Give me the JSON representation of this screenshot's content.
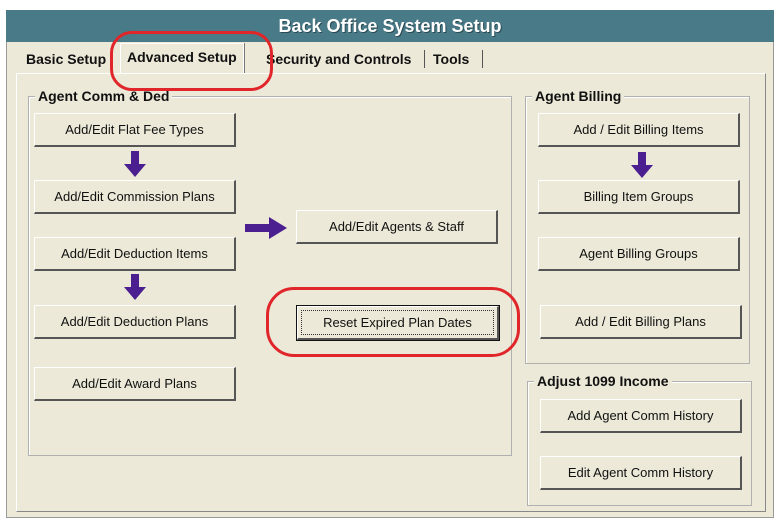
{
  "window": {
    "title": "Back Office System Setup"
  },
  "tabs": [
    {
      "label": "Basic Setup"
    },
    {
      "label": "Advanced Setup"
    },
    {
      "label": "Security and Controls"
    },
    {
      "label": "Tools"
    }
  ],
  "agent_comm": {
    "legend": "Agent Comm & Ded",
    "flat_fee": "Add/Edit Flat Fee Types",
    "commission_plans": "Add/Edit Commission Plans",
    "deduction_items": "Add/Edit Deduction Items",
    "deduction_plans": "Add/Edit Deduction Plans",
    "award_plans": "Add/Edit Award Plans",
    "agents_staff": "Add/Edit Agents & Staff",
    "reset_expired": "Reset Expired Plan Dates"
  },
  "agent_billing": {
    "legend": "Agent Billing",
    "billing_items": "Add / Edit Billing Items",
    "billing_item_groups": "Billing Item Groups",
    "agent_billing_groups": "Agent Billing Groups",
    "billing_plans": "Add / Edit Billing Plans"
  },
  "adjust_1099": {
    "legend": "Adjust 1099 Income",
    "add_history": "Add Agent Comm History",
    "edit_history": "Edit Agent Comm History"
  },
  "colors": {
    "titlebar": "#487a87",
    "arrow": "#4b1f8f",
    "highlight": "#e0262a",
    "window_bg": "#ece9d8"
  },
  "icons": {
    "down_arrow": "down-arrow-icon",
    "right_arrow": "right-arrow-icon"
  }
}
